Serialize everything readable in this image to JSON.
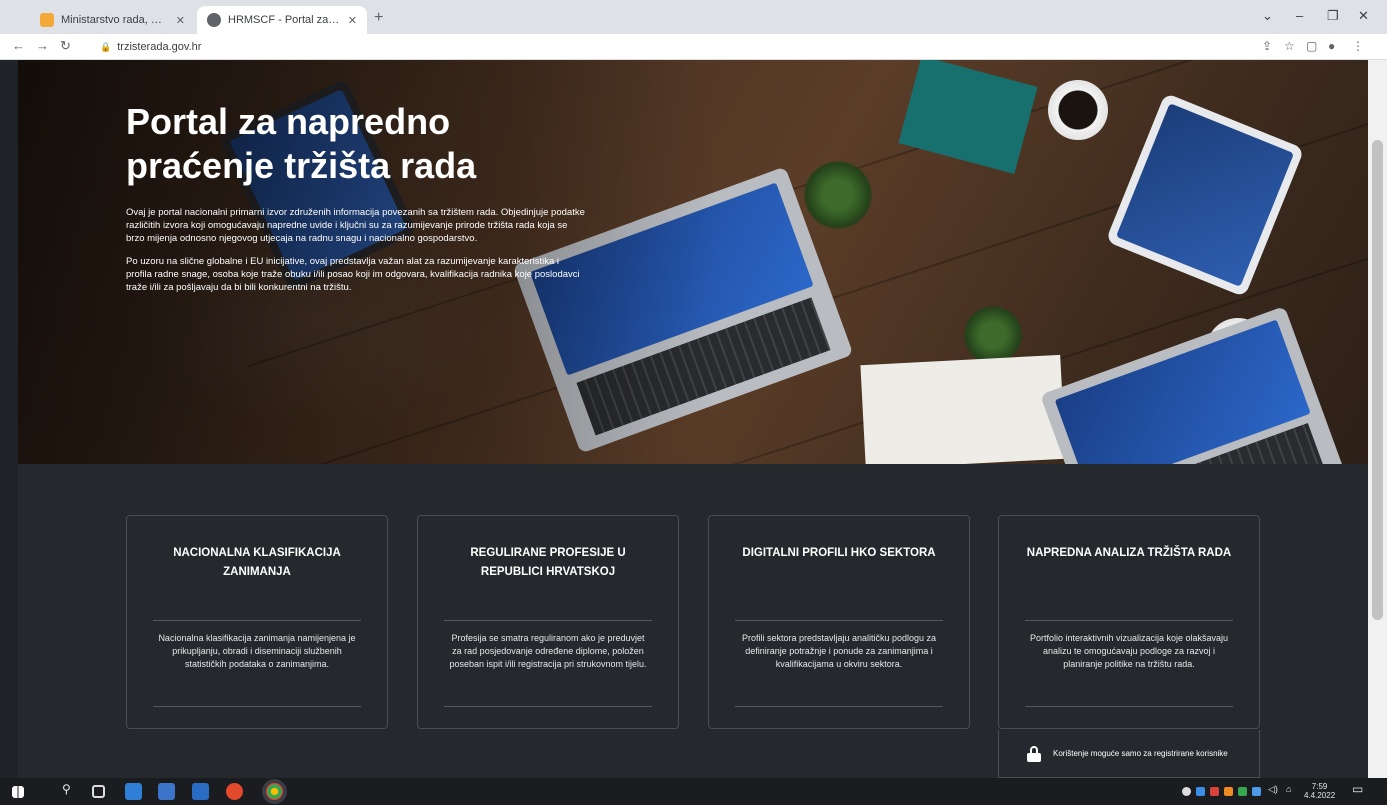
{
  "browser": {
    "tabs": [
      {
        "title": "Ministarstvo rada, mirovinskog"
      },
      {
        "title": "HRMSCF - Portal za napredno"
      }
    ],
    "url": "trzisterada.gov.hr"
  },
  "hero": {
    "title_line1": "Portal za napredno",
    "title_line2": "praćenje tržišta rada",
    "paragraph1": "Ovaj je portal nacionalni primarni izvor združenih informacija povezanih sa tržištem rada. Objedinjuje podatke različitih izvora koji omogućavaju napredne uvide i ključni su za razumijevanje prirode tržišta rada koja se brzo mijenja odnosno njegovog utjecaja na radnu snagu i nacionalno gospodarstvo.",
    "paragraph2": "Po uzoru na slične globalne i EU inicijative, ovaj predstavlja važan alat za razumijevanje karakteristika i profila radne snage, osoba koje traže obuku i/ili posao koji im odgovara, kvalifikacija radnika koje poslodavci traže i/ili za pošljavaju da bi bili konkurentni na tržištu."
  },
  "cards": [
    {
      "title": "NACIONALNA KLASIFIKACIJA ZANIMANJA",
      "text": "Nacionalna klasifikacija zanimanja namijenjena je prikupljanju, obradi i diseminaciji službenih statističkih podataka o zanimanjima."
    },
    {
      "title": "REGULIRANE PROFESIJE U REPUBLICI HRVATSKOJ",
      "text": "Profesija se smatra reguliranom ako je preduvjet za rad posjedovanje određene diplome, položen poseban ispit i/ili registracija pri strukovnom tijelu."
    },
    {
      "title": "DIGITALNI PROFILI HKO SEKTORA",
      "text": "Profili sektora predstavljaju analitičku podlogu za definiranje potražnje i ponude za zanimanjima i kvalifikacijama u okviru sektora."
    },
    {
      "title": "NAPREDNA ANALIZA TRŽIŠTA RADA",
      "text": "Portfolio interaktivnih vizualizacija koje olakšavaju analizu te omogućavaju podloge za razvoj i planiranje politike na tržištu rada."
    }
  ],
  "restricted_note": "Korištenje moguće samo za registrirane korisnike",
  "taskbar": {
    "time": "7:59",
    "date": "4.4.2022"
  }
}
